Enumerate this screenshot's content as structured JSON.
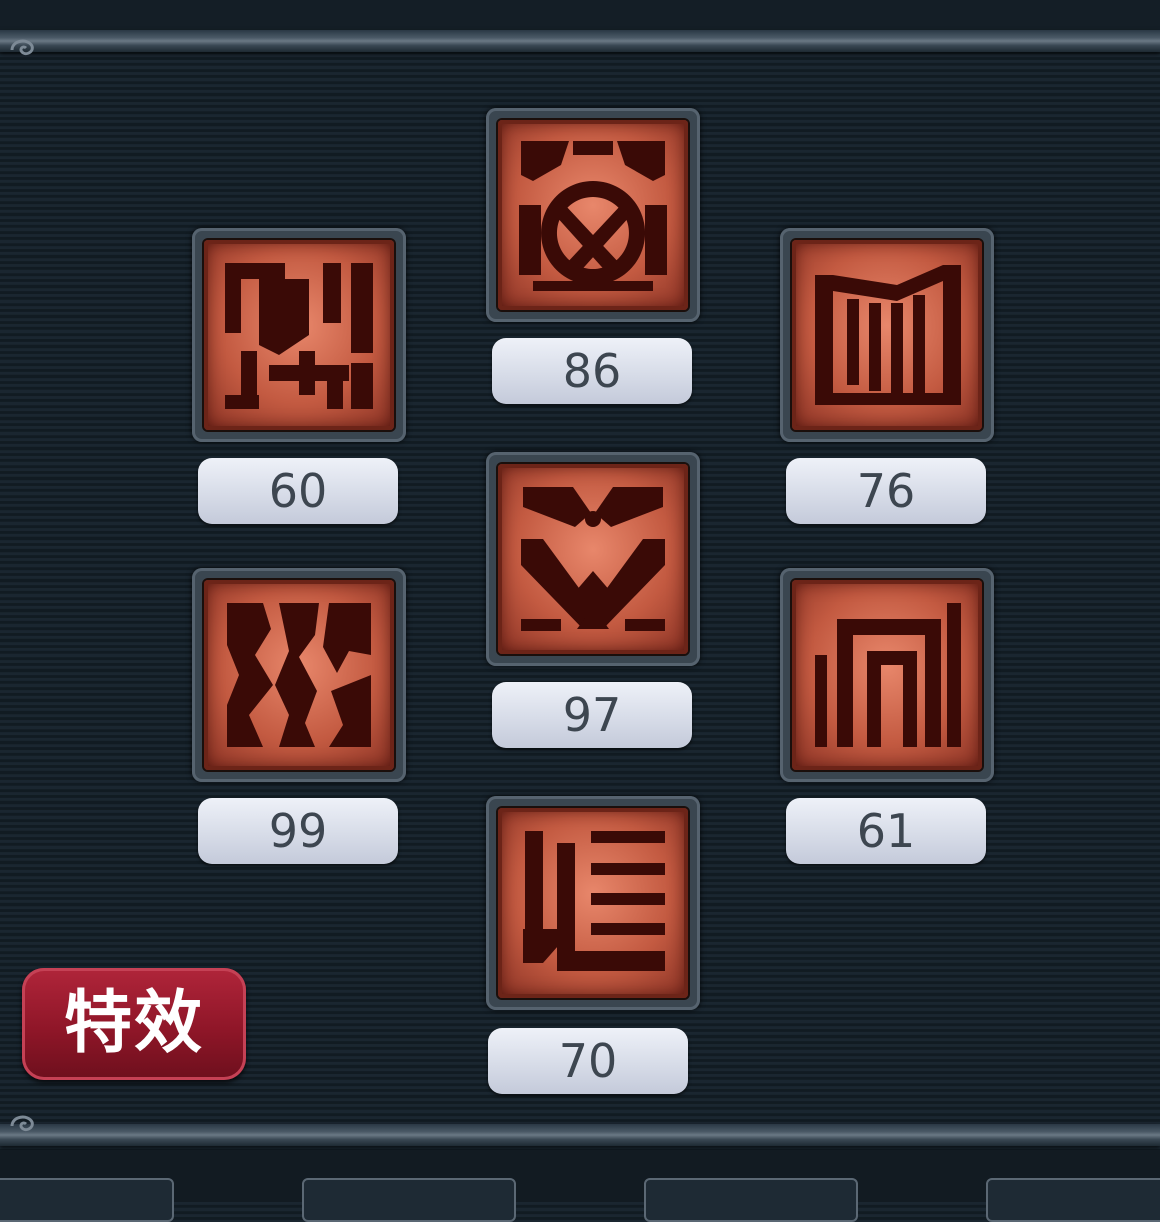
{
  "effects_button": {
    "label": "特效"
  },
  "slots": [
    {
      "id": "top-center",
      "icon": "hammer-wheel-icon",
      "value": "86"
    },
    {
      "id": "upper-left",
      "icon": "rune-glyph-a-icon",
      "value": "60"
    },
    {
      "id": "upper-right",
      "icon": "gate-bars-icon",
      "value": "76"
    },
    {
      "id": "middle-center",
      "icon": "crossed-hammers-icon",
      "value": "97"
    },
    {
      "id": "lower-left",
      "icon": "cracked-rune-icon",
      "value": "99"
    },
    {
      "id": "lower-right",
      "icon": "nested-frame-icon",
      "value": "61"
    },
    {
      "id": "bottom-center",
      "icon": "bracket-lines-icon",
      "value": "70"
    }
  ],
  "colors": {
    "background": "#16222b",
    "slot_copper": "#c35a41",
    "glyph_dark": "#3a0a06",
    "pill": "#d7dce8",
    "pill_text": "#3d4650",
    "button_red": "#8f1628"
  }
}
